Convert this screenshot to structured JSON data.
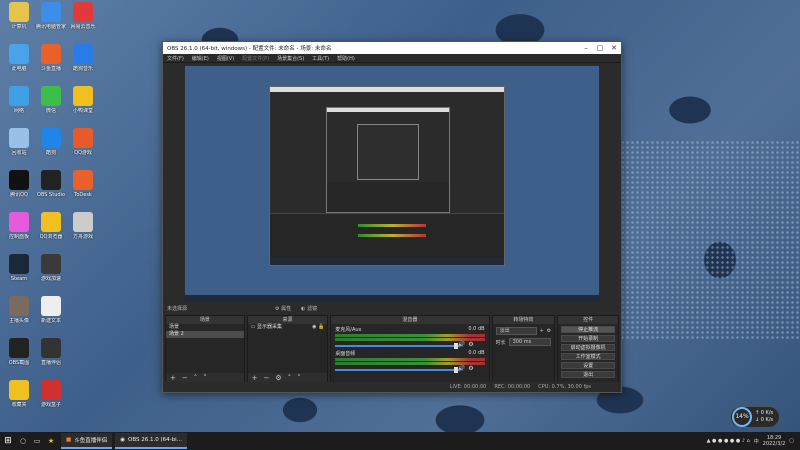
{
  "obs": {
    "title": "OBS 26.1.0 (64-bit, windows) - 配置文件: 未命名 - 场景: 未命名",
    "menus": [
      "文件(F)",
      "编辑(E)",
      "视图(V)",
      "配置文件(P)",
      "场景集合(S)",
      "工具(T)",
      "帮助(H)"
    ],
    "no_source": "未选择源",
    "props": "属性",
    "filters": "滤镜",
    "docks": {
      "scenes": {
        "title": "场景",
        "items": [
          "场景",
          "场景 2"
        ]
      },
      "sources": {
        "title": "来源",
        "items": [
          "显示器采集"
        ]
      },
      "mixer": {
        "title": "混音器",
        "tracks": [
          {
            "name": "麦克风/Aux",
            "level": "0.0 dB"
          },
          {
            "name": "桌面音频",
            "level": "0.0 dB"
          }
        ]
      },
      "transitions": {
        "title": "转场特效",
        "type": "淡出",
        "duration_label": "时长",
        "duration": "300 ms"
      },
      "controls": {
        "title": "控件",
        "buttons": [
          "停止推流",
          "开始录制",
          "启动虚拟摄像机",
          "工作室模式",
          "设置",
          "退出"
        ]
      }
    },
    "status": {
      "live": "LIVE: 00:00:00",
      "rec": "REC: 00:00:00",
      "cpu": "CPU: 0.7%, 30.00 fps"
    }
  },
  "desktop_icons": [
    {
      "label": "计算机",
      "color": "#e6c34a"
    },
    {
      "label": "腾讯电脑管家",
      "color": "#3b8fe8"
    },
    {
      "label": "网易云音乐",
      "color": "#e03a3a"
    },
    {
      "label": "此电脑",
      "color": "#4aa3e8"
    },
    {
      "label": "斗鱼直播",
      "color": "#e8602a"
    },
    {
      "label": "酷狗音乐",
      "color": "#2a7be8"
    },
    {
      "label": "网络",
      "color": "#3fa0e6"
    },
    {
      "label": "微信",
      "color": "#3bbf4a"
    },
    {
      "label": "小鸭课堂",
      "color": "#f0c020"
    },
    {
      "label": "回收站",
      "color": "#9bc0e8"
    },
    {
      "label": "酷狗",
      "color": "#1d86e8"
    },
    {
      "label": "QQ游戏",
      "color": "#e85a2a"
    },
    {
      "label": "腾讯QQ",
      "color": "#111111"
    },
    {
      "label": "OBS Studio",
      "color": "#222222"
    },
    {
      "label": "ToDesk",
      "color": "#e8602a"
    },
    {
      "label": "控制面板",
      "color": "#e85adc"
    },
    {
      "label": "QQ浏览器",
      "color": "#f0c020"
    },
    {
      "label": "方舟游戏",
      "color": "#cccccc"
    },
    {
      "label": "Steam",
      "color": "#1b2838"
    },
    {
      "label": "游戏加速",
      "color": "#3a3a3a"
    },
    {
      "label": "主播头像",
      "color": "#7a6a60"
    },
    {
      "label": "新建文本",
      "color": "#eeeeee"
    },
    {
      "label": "OBS截图",
      "color": "#222222"
    },
    {
      "label": "直播伴侣",
      "color": "#333333"
    },
    {
      "label": "收藏夹",
      "color": "#f0c020"
    },
    {
      "label": "游戏盒子",
      "color": "#d03030"
    }
  ],
  "taskbar": {
    "apps": [
      {
        "label": "斗鱼直播伴侣"
      },
      {
        "label": "OBS 26.1.0 (64-bi..."
      }
    ],
    "time": "18:29",
    "date": "2022/3/2",
    "lang": "中"
  },
  "net_widget": {
    "percent": "14%",
    "up": "0 K/s",
    "down": "0 K/s"
  }
}
